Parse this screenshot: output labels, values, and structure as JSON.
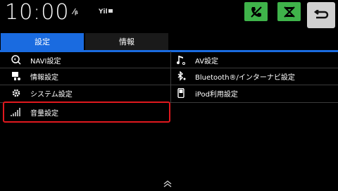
{
  "status": {
    "time": "10:00",
    "bt_indicator": "⁄ᵦ",
    "signal_indicator": "Yil"
  },
  "tabs": [
    {
      "label": "設定",
      "active": true
    },
    {
      "label": "情報",
      "active": false
    }
  ],
  "menu": {
    "left": [
      {
        "label": "NAVI設定",
        "icon": "navi-settings-icon"
      },
      {
        "label": "情報設定",
        "icon": "info-settings-icon"
      },
      {
        "label": "システム設定",
        "icon": "gear-icon"
      },
      {
        "label": "音量設定",
        "icon": "volume-bars-icon"
      }
    ],
    "right": [
      {
        "label": "AV設定",
        "icon": "music-note-icon"
      },
      {
        "label": "Bluetooth®/インターナビ設定",
        "icon": "bluetooth-icon"
      },
      {
        "label": "iPod利用設定",
        "icon": "ipod-icon"
      }
    ]
  },
  "colors": {
    "accent": "#1a6be0",
    "highlight": "#e0181e",
    "green": "#3fb34a"
  }
}
